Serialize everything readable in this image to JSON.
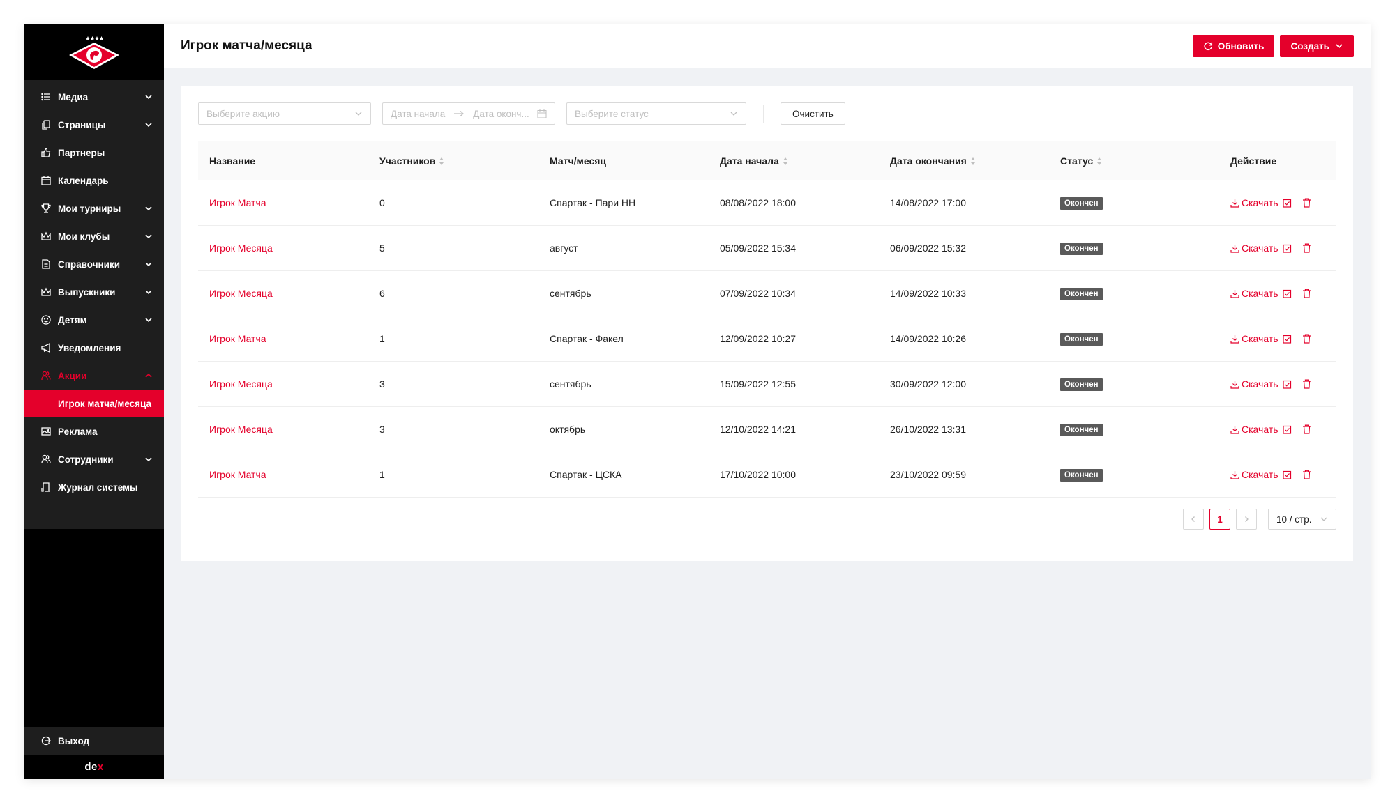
{
  "colors": {
    "accent": "#e4002b",
    "sidebar_bg": "#1e1e1e",
    "status_bg": "#5a5a5a"
  },
  "sidebar": {
    "items": [
      {
        "label": "Медиа",
        "icon": "list-icon",
        "expandable": true
      },
      {
        "label": "Страницы",
        "icon": "file-copy-icon",
        "expandable": true
      },
      {
        "label": "Партнеры",
        "icon": "like-icon",
        "expandable": false
      },
      {
        "label": "Календарь",
        "icon": "calendar-icon",
        "expandable": false
      },
      {
        "label": "Мои турниры",
        "icon": "trophy-icon",
        "expandable": true
      },
      {
        "label": "Мои клубы",
        "icon": "crown-icon",
        "expandable": true
      },
      {
        "label": "Справочники",
        "icon": "file-icon",
        "expandable": true
      },
      {
        "label": "Выпускники",
        "icon": "crown-icon",
        "expandable": true
      },
      {
        "label": "Детям",
        "icon": "smile-icon",
        "expandable": true
      },
      {
        "label": "Уведомления",
        "icon": "sound-icon",
        "expandable": false
      },
      {
        "label": "Акции",
        "icon": "users-icon",
        "expandable": true,
        "open": true
      },
      {
        "label": "Игрок матча/месяца",
        "selected": true
      },
      {
        "label": "Реклама",
        "icon": "picture-icon",
        "expandable": false
      },
      {
        "label": "Сотрудники",
        "icon": "users-icon",
        "expandable": true
      },
      {
        "label": "Журнал системы",
        "icon": "audit-icon",
        "expandable": false
      }
    ],
    "logout": "Выход",
    "brand": "dex"
  },
  "header": {
    "title": "Игрок матча/месяца",
    "refresh_label": "Обновить",
    "create_label": "Создать"
  },
  "filters": {
    "promo_placeholder": "Выберите акцию",
    "start_placeholder": "Дата начала",
    "end_placeholder": "Дата оконч...",
    "status_placeholder": "Выберите статус",
    "clear_label": "Очистить"
  },
  "table": {
    "columns": [
      "Название",
      "Участников",
      "Матч/месяц",
      "Дата начала",
      "Дата окончания",
      "Статус",
      "Действие"
    ],
    "download_label": "Скачать",
    "rows": [
      {
        "name": "Игрок Матча",
        "participants": "0",
        "match": "Спартак - Пари НН",
        "start": "08/08/2022 18:00",
        "end": "14/08/2022 17:00",
        "status": "Окончен"
      },
      {
        "name": "Игрок Месяца",
        "participants": "5",
        "match": "август",
        "start": "05/09/2022 15:34",
        "end": "06/09/2022 15:32",
        "status": "Окончен"
      },
      {
        "name": "Игрок Месяца",
        "participants": "6",
        "match": "сентябрь",
        "start": "07/09/2022 10:34",
        "end": "14/09/2022 10:33",
        "status": "Окончен"
      },
      {
        "name": "Игрок Матча",
        "participants": "1",
        "match": "Спартак - Факел",
        "start": "12/09/2022 10:27",
        "end": "14/09/2022 10:26",
        "status": "Окончен"
      },
      {
        "name": "Игрок Месяца",
        "participants": "3",
        "match": "сентябрь",
        "start": "15/09/2022 12:55",
        "end": "30/09/2022 12:00",
        "status": "Окончен"
      },
      {
        "name": "Игрок Месяца",
        "participants": "3",
        "match": "октябрь",
        "start": "12/10/2022 14:21",
        "end": "26/10/2022 13:31",
        "status": "Окончен"
      },
      {
        "name": "Игрок Матча",
        "participants": "1",
        "match": "Спартак - ЦСКА",
        "start": "17/10/2022 10:00",
        "end": "23/10/2022 09:59",
        "status": "Окончен"
      }
    ]
  },
  "pagination": {
    "current_page": "1",
    "page_size": "10 / стр."
  }
}
